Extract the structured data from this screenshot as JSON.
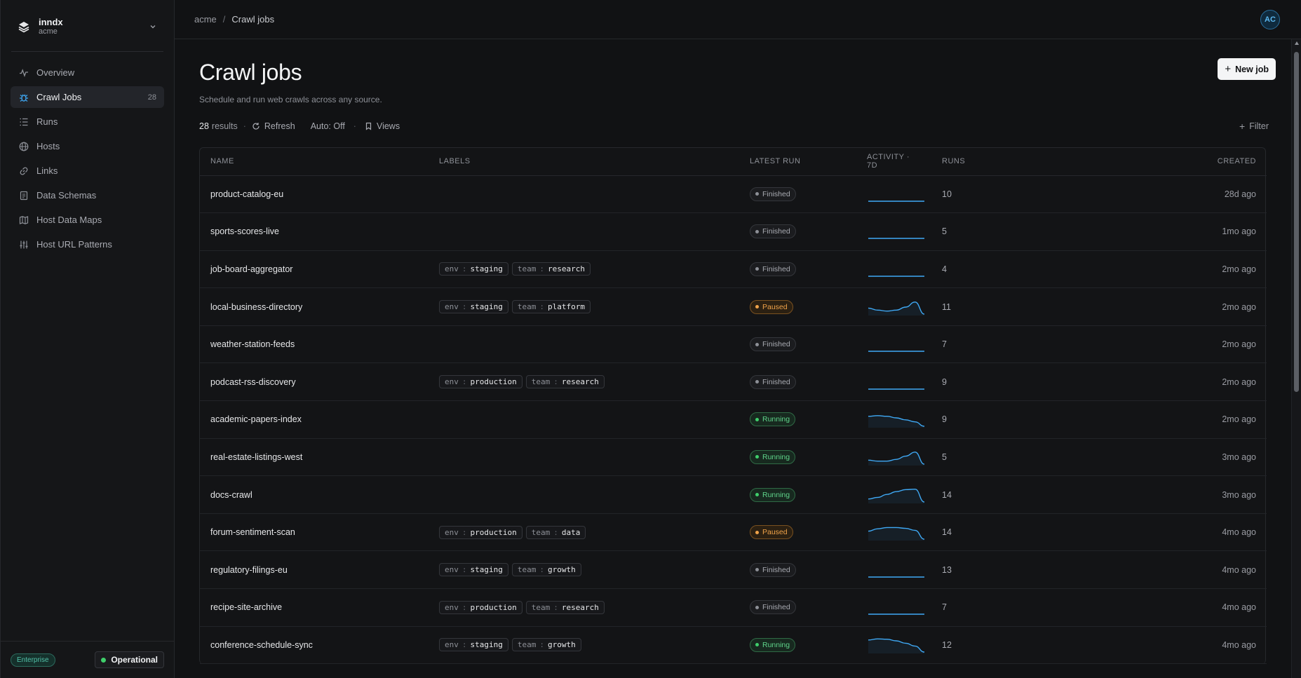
{
  "workspace": {
    "name": "inndx",
    "org": "acme"
  },
  "nav": [
    {
      "label": "Overview",
      "icon": "activity-icon",
      "active": false,
      "count": ""
    },
    {
      "label": "Crawl Jobs",
      "icon": "bug-icon",
      "active": true,
      "count": "28"
    },
    {
      "label": "Runs",
      "icon": "list-icon",
      "active": false,
      "count": ""
    },
    {
      "label": "Hosts",
      "icon": "globe-icon",
      "active": false,
      "count": ""
    },
    {
      "label": "Links",
      "icon": "link-icon",
      "active": false,
      "count": ""
    },
    {
      "label": "Data Schemas",
      "icon": "schema-icon",
      "active": false,
      "count": ""
    },
    {
      "label": "Host Data Maps",
      "icon": "map-icon",
      "active": false,
      "count": ""
    },
    {
      "label": "Host URL Patterns",
      "icon": "sliders-icon",
      "active": false,
      "count": ""
    }
  ],
  "footer": {
    "plan": "Enterprise",
    "status": "Operational"
  },
  "breadcrumb": {
    "root": "acme",
    "current": "Crawl jobs"
  },
  "user": {
    "initials": "AC"
  },
  "page": {
    "title": "Crawl jobs",
    "subtitle": "Schedule and run web crawls across any source.",
    "new_button": "New job"
  },
  "toolbar": {
    "count": "28",
    "results_label": "results",
    "refresh": "Refresh",
    "auto": "Auto: Off",
    "views": "Views",
    "filter": "Filter"
  },
  "table": {
    "columns": [
      "NAME",
      "LABELS",
      "LATEST RUN",
      "ACTIVITY · 7D",
      "RUNS",
      "CREATED"
    ],
    "rows": [
      {
        "name": "product-catalog-eu",
        "labels": [],
        "status": "Finished",
        "activity": [
          0,
          0,
          0,
          0,
          0,
          0,
          0
        ],
        "runs": "10",
        "created": "28d ago"
      },
      {
        "name": "sports-scores-live",
        "labels": [],
        "status": "Finished",
        "activity": [
          0,
          0,
          0,
          0,
          0,
          0,
          0
        ],
        "runs": "5",
        "created": "1mo ago"
      },
      {
        "name": "job-board-aggregator",
        "labels": [
          {
            "key": "env",
            "value": "staging"
          },
          {
            "key": "team",
            "value": "research"
          }
        ],
        "status": "Finished",
        "activity": [
          0,
          0,
          0,
          0,
          0,
          0,
          0
        ],
        "runs": "4",
        "created": "2mo ago"
      },
      {
        "name": "local-business-directory",
        "labels": [
          {
            "key": "env",
            "value": "staging"
          },
          {
            "key": "team",
            "value": "platform"
          }
        ],
        "status": "Paused",
        "activity": [
          3,
          2,
          1.5,
          2,
          3.5,
          6,
          0
        ],
        "runs": "11",
        "created": "2mo ago"
      },
      {
        "name": "weather-station-feeds",
        "labels": [],
        "status": "Finished",
        "activity": [
          0,
          0,
          0,
          0,
          0,
          0,
          0
        ],
        "runs": "7",
        "created": "2mo ago"
      },
      {
        "name": "podcast-rss-discovery",
        "labels": [
          {
            "key": "env",
            "value": "production"
          },
          {
            "key": "team",
            "value": "research"
          }
        ],
        "status": "Finished",
        "activity": [
          0,
          0,
          0,
          0,
          0,
          0,
          0
        ],
        "runs": "9",
        "created": "2mo ago"
      },
      {
        "name": "academic-papers-index",
        "labels": [],
        "status": "Running",
        "activity": [
          5,
          5.3,
          5,
          4.2,
          3.2,
          2.2,
          0
        ],
        "runs": "9",
        "created": "2mo ago"
      },
      {
        "name": "real-estate-listings-west",
        "labels": [],
        "status": "Running",
        "activity": [
          2,
          1.5,
          1.5,
          2.4,
          4,
          6,
          0
        ],
        "runs": "5",
        "created": "3mo ago"
      },
      {
        "name": "docs-crawl",
        "labels": [],
        "status": "Running",
        "activity": [
          1.5,
          2.3,
          3.8,
          5.2,
          6.2,
          6.4,
          0
        ],
        "runs": "14",
        "created": "3mo ago"
      },
      {
        "name": "forum-sentiment-scan",
        "labels": [
          {
            "key": "env",
            "value": "production"
          },
          {
            "key": "team",
            "value": "data"
          }
        ],
        "status": "Paused",
        "activity": [
          4,
          5.2,
          5.8,
          5.8,
          5.4,
          4.4,
          0
        ],
        "runs": "14",
        "created": "4mo ago"
      },
      {
        "name": "regulatory-filings-eu",
        "labels": [
          {
            "key": "env",
            "value": "staging"
          },
          {
            "key": "team",
            "value": "growth"
          }
        ],
        "status": "Finished",
        "activity": [
          0,
          0,
          0,
          0,
          0,
          0,
          0
        ],
        "runs": "13",
        "created": "4mo ago"
      },
      {
        "name": "recipe-site-archive",
        "labels": [
          {
            "key": "env",
            "value": "production"
          },
          {
            "key": "team",
            "value": "research"
          }
        ],
        "status": "Finished",
        "activity": [
          0,
          0,
          0,
          0,
          0,
          0,
          0
        ],
        "runs": "7",
        "created": "4mo ago"
      },
      {
        "name": "conference-schedule-sync",
        "labels": [
          {
            "key": "env",
            "value": "staging"
          },
          {
            "key": "team",
            "value": "growth"
          }
        ],
        "status": "Running",
        "activity": [
          6,
          6.6,
          6.4,
          5.6,
          4.4,
          3,
          0
        ],
        "runs": "12",
        "created": "4mo ago"
      }
    ]
  },
  "colors": {
    "accent": "#3fa9f5",
    "running": "#3fcf6b",
    "paused": "#f0a34a",
    "background": "#111214"
  }
}
